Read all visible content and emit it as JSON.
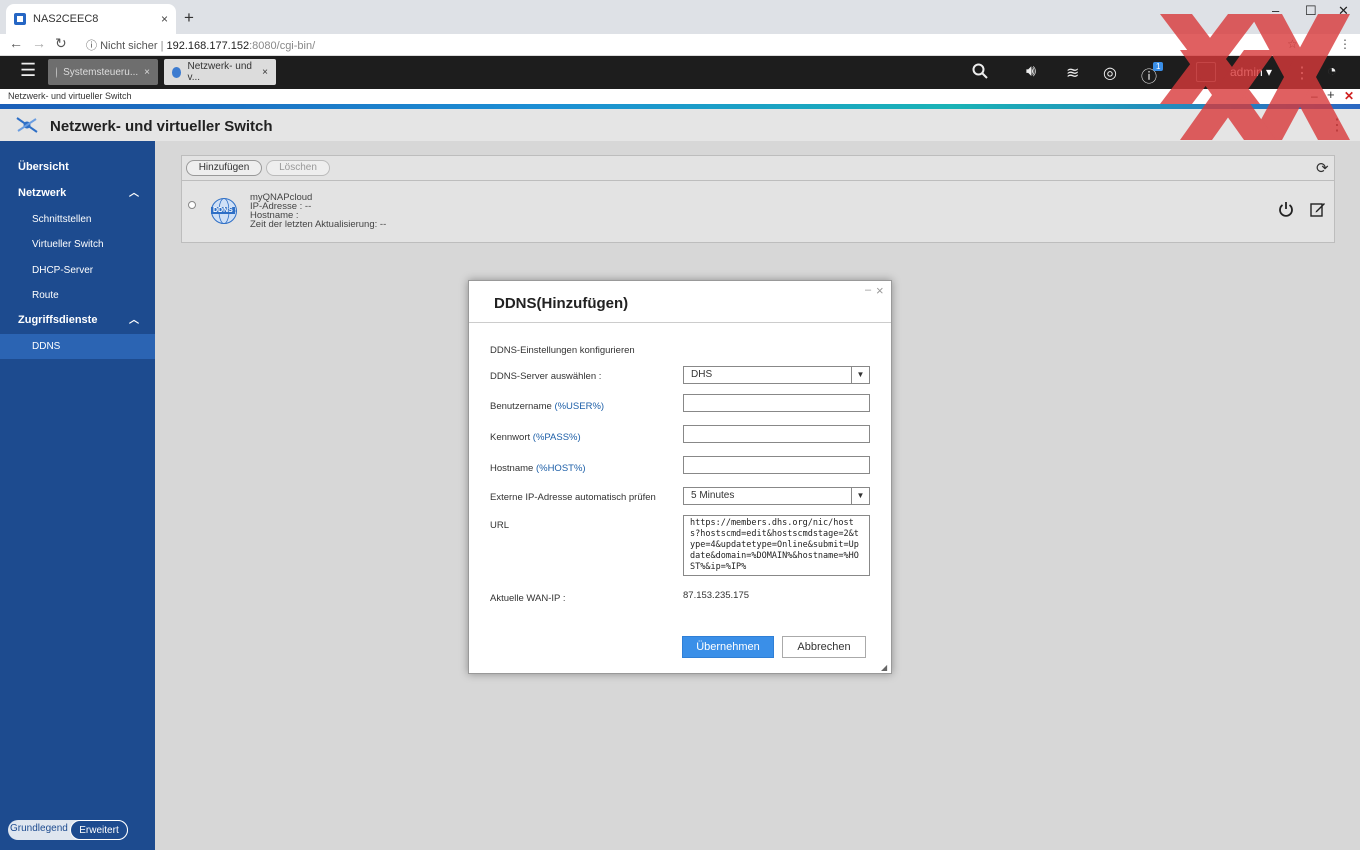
{
  "browser": {
    "tab_title": "NAS2CEEC8",
    "tab_close": "×",
    "new_tab": "+",
    "security": "Nicht sicher",
    "url_host": "192.168.177.152",
    "url_path": ":8080/cgi-bin/",
    "minimize": "–",
    "maximize": "☐",
    "close": "✕"
  },
  "qts_bar": {
    "tabs": [
      {
        "label": "Systemsteueru...",
        "close": "×"
      },
      {
        "label": "Netzwerk- und v...",
        "close": "×"
      }
    ],
    "notification_count": "1",
    "user": "admin ▾"
  },
  "window_bar": {
    "title": "Netzwerk- und virtueller Switch",
    "minimize": "–",
    "maximize": "+",
    "close": "✕"
  },
  "app": {
    "title": "Netzwerk- und virtueller Switch"
  },
  "sidebar": {
    "items": [
      {
        "label": "Übersicht"
      },
      {
        "label": "Netzwerk"
      },
      {
        "label": "Schnittstellen"
      },
      {
        "label": "Virtueller Switch"
      },
      {
        "label": "DHCP-Server"
      },
      {
        "label": "Route"
      },
      {
        "label": "Zugriffsdienste"
      },
      {
        "label": "DDNS"
      }
    ],
    "mode_basic": "Grundlegend",
    "mode_advanced": "Erweitert"
  },
  "toolbar": {
    "add_label": "Hinzufügen",
    "delete_label": "Löschen"
  },
  "ddns_entry": {
    "badge": "DDNS",
    "name": "myQNAPcloud",
    "ip": "IP-Adresse : --",
    "hostname": "Hostname :",
    "last_update": "Zeit der letzten Aktualisierung: --"
  },
  "dialog": {
    "title": "DDNS(Hinzufügen)",
    "minimize": "–",
    "close": "×",
    "section": "DDNS-Einstellungen konfigurieren",
    "server_label": "DDNS-Server auswählen :",
    "server_value": "DHS",
    "username_label": "Benutzername",
    "username_var": "(%USER%)",
    "password_label": "Kennwort",
    "password_var": "(%PASS%)",
    "hostname_label": "Hostname",
    "hostname_var": "(%HOST%)",
    "check_label": "Externe IP-Adresse automatisch prüfen",
    "check_value": "5 Minutes",
    "url_label": "URL",
    "url_value": "https://members.dhs.org/nic/hosts?hostscmd=edit&hostscmdstage=2&type=4&updatetype=Online&submit=Update&domain=%DOMAIN%&hostname=%HOST%&ip=%IP%",
    "wan_label": "Aktuelle WAN-IP :",
    "wan_value": "87.153.235.175",
    "apply": "Übernehmen",
    "cancel": "Abbrechen"
  }
}
